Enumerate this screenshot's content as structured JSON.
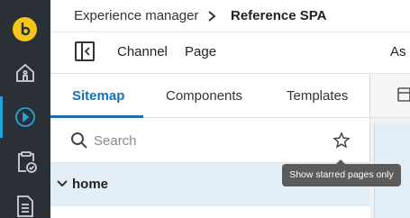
{
  "rail": {
    "logo_icon": "bloomreach-logo-icon",
    "items": [
      {
        "icon": "home-icon",
        "active": false
      },
      {
        "icon": "play-circle-icon",
        "active": true
      },
      {
        "icon": "clipboard-check-icon",
        "active": false
      },
      {
        "icon": "document-icon",
        "active": false
      }
    ],
    "colors": {
      "background": "#2b3036",
      "accent": "#1fa4dc",
      "logo": "#f5c518"
    }
  },
  "header": {
    "breadcrumb_root": "Experience manager",
    "breadcrumb_current": "Reference SPA"
  },
  "toolbar": {
    "sidebar_toggle_icon": "sidebar-collapse-icon",
    "channel_label": "Channel",
    "page_label": "Page",
    "truncated_label": "As v"
  },
  "panel": {
    "tabs": [
      {
        "label": "Sitemap",
        "active": true
      },
      {
        "label": "Components",
        "active": false
      },
      {
        "label": "Templates",
        "active": false
      }
    ],
    "search": {
      "placeholder": "Search",
      "value": ""
    },
    "tree": [
      {
        "label": "home",
        "expanded": true,
        "selected": true
      }
    ]
  },
  "tooltip": {
    "text": "Show starred pages only"
  },
  "colors": {
    "primary": "#1a6fb3",
    "selected_row": "#e3eef7",
    "tooltip_bg": "#5b5b5b"
  }
}
